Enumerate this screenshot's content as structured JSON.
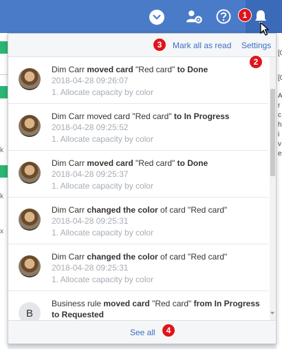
{
  "topbar": {
    "icons": [
      "chevron-down-icon",
      "users-settings-icon",
      "help-icon",
      "bell-icon"
    ],
    "accent": "#4a7bc8"
  },
  "panel": {
    "mark_all_label": "Mark all as read",
    "settings_label": "Settings",
    "see_all_label": "See all",
    "items": [
      {
        "actor": "Dim Carr",
        "segments": [
          [
            "moved card",
            true
          ],
          [
            " \"Red card\" ",
            false
          ],
          [
            "to Done",
            true
          ]
        ],
        "time": "2018-04-28 09:26:07",
        "board": "1. Allocate capacity by color",
        "avatar": "photo"
      },
      {
        "actor": "Dim Carr",
        "segments": [
          [
            " moved card \"Red card\" ",
            false
          ],
          [
            "to In Progress",
            true
          ]
        ],
        "time": "2018-04-28 09:25:52",
        "board": "1. Allocate capacity by color",
        "avatar": "photo"
      },
      {
        "actor": "Dim Carr",
        "segments": [
          [
            "moved card",
            true
          ],
          [
            " \"Red card\" ",
            false
          ],
          [
            "to Done",
            true
          ]
        ],
        "time": "2018-04-28 09:25:37",
        "board": "1. Allocate capacity by color",
        "avatar": "photo"
      },
      {
        "actor": "Dim Carr",
        "segments": [
          [
            "changed the color",
            true
          ],
          [
            " of card \"Red card\"",
            false
          ]
        ],
        "time": "2018-04-28 09:25:31",
        "board": "1. Allocate capacity by color",
        "avatar": "photo"
      },
      {
        "actor": "Dim Carr",
        "segments": [
          [
            "changed the color",
            true
          ],
          [
            " of card \"Red card\"",
            false
          ]
        ],
        "time": "2018-04-28 09:25:31",
        "board": "1. Allocate capacity by color",
        "avatar": "photo"
      },
      {
        "actor": "Business rule",
        "segments": [
          [
            "moved card",
            true
          ],
          [
            " \"Red card\" ",
            false
          ],
          [
            "from In Progress to Requested",
            true
          ]
        ],
        "time": "",
        "board": "",
        "avatar": "B"
      }
    ]
  },
  "badges": [
    "1",
    "2",
    "3",
    "4"
  ],
  "badge_color": "#e0141b",
  "background": {
    "right_text": [
      "[0",
      "[0",
      "A",
      "r",
      "c",
      "h",
      "i",
      "v",
      "e"
    ],
    "left_text": [
      "k",
      "k",
      "x"
    ]
  }
}
